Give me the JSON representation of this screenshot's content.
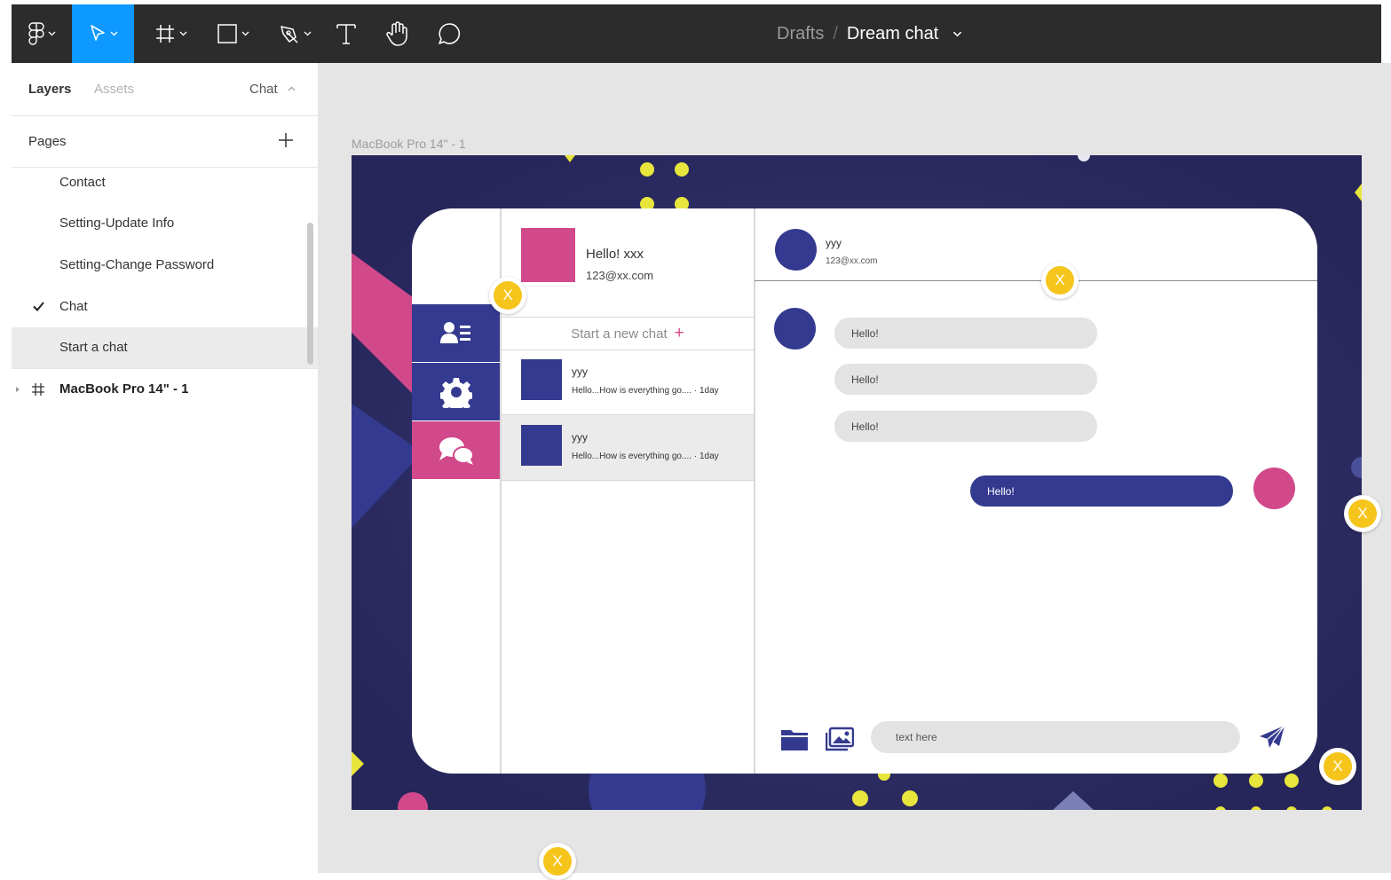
{
  "toolbar": {
    "tools": [
      "main-menu",
      "move",
      "frame",
      "shape",
      "pen",
      "text",
      "hand",
      "comment"
    ],
    "breadcrumb": {
      "parent": "Drafts",
      "separator": "/",
      "file": "Dream chat"
    }
  },
  "left_panel": {
    "tabs": {
      "layers": "Layers",
      "assets": "Assets",
      "current_page": "Chat"
    },
    "pages_title": "Pages",
    "pages": [
      {
        "label": "Contact",
        "checked": false
      },
      {
        "label": "Setting-Update Info",
        "checked": false
      },
      {
        "label": "Setting-Change Password",
        "checked": false
      },
      {
        "label": "Chat",
        "checked": true
      },
      {
        "label": "Start a chat",
        "checked": false
      }
    ],
    "layers": [
      {
        "label": "MacBook Pro 14\" - 1"
      }
    ]
  },
  "canvas": {
    "frame_label": "MacBook Pro 14\" - 1",
    "app": {
      "profile": {
        "greeting": "Hello! xxx",
        "email": "123@xx.com"
      },
      "new_chat_label": "Start a new chat",
      "new_chat_icon": "+",
      "chats": [
        {
          "name": "yyy",
          "preview": "Hello...How is everything go.... · 1day"
        },
        {
          "name": "yyy",
          "preview": "Hello...How is everything go.... · 1day"
        }
      ],
      "conversation": {
        "contact_name": "yyy",
        "contact_email": "123@xx.com",
        "incoming": [
          "Hello!",
          "Hello!",
          "Hello!"
        ],
        "outgoing": [
          "Hello!"
        ]
      },
      "composer": {
        "placeholder": "text here"
      },
      "colors": {
        "navy": "#343a8f",
        "pink": "#d1488b",
        "background": "#2a2a5e",
        "accent": "#e8e53c"
      }
    },
    "comment_pins": [
      "X",
      "X",
      "X",
      "X",
      "X"
    ]
  }
}
